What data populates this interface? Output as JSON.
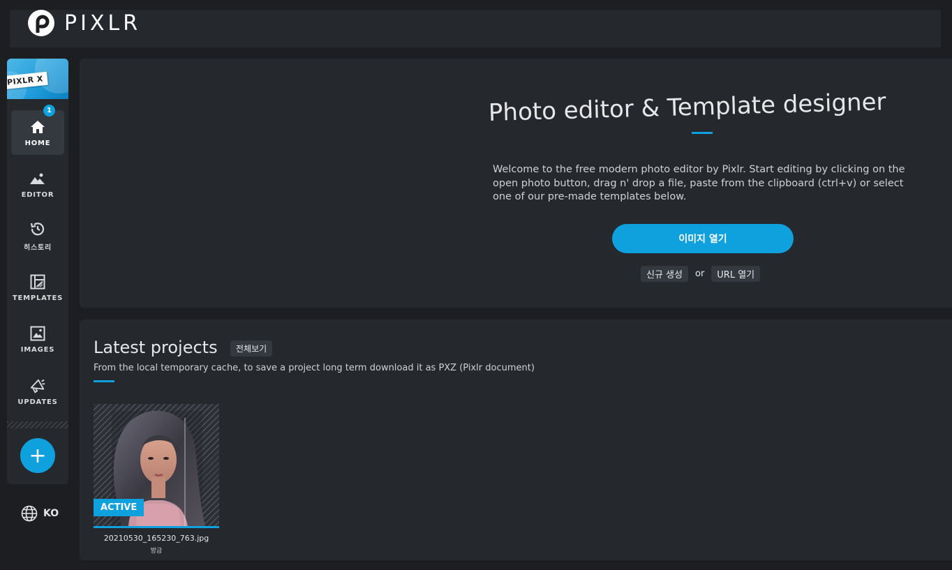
{
  "app": {
    "logo_text": "PIXLR",
    "brand_badge": "PIXLR X"
  },
  "sidebar": {
    "items": [
      {
        "label": "HOME",
        "icon": "home-icon",
        "active": true
      },
      {
        "label": "EDITOR",
        "icon": "image-edit-icon",
        "badge": "1"
      },
      {
        "label": "히스토리",
        "icon": "history-icon"
      },
      {
        "label": "TEMPLATES",
        "icon": "templates-icon"
      },
      {
        "label": "IMAGES",
        "icon": "images-icon"
      },
      {
        "label": "UPDATES",
        "icon": "megaphone-icon"
      }
    ],
    "add_button": "+",
    "language": "KO"
  },
  "hero": {
    "title": "Photo editor & Template designer",
    "description": "Welcome to the free modern photo editor by Pixlr. Start editing by clicking on the open photo button, drag n' drop a file, paste from the clipboard (ctrl+v) or select one of our pre-made templates below.",
    "open_button": "이미지 열기",
    "new_button": "신규 생성",
    "or_text": "or",
    "url_button": "URL 열기"
  },
  "projects": {
    "title": "Latest projects",
    "view_all": "전체보기",
    "subtitle": "From the local temporary cache, to save a project long term download it as PXZ (Pixlr document)",
    "items": [
      {
        "status": "ACTIVE",
        "file_name": "20210530_165230_763.jpg",
        "time": "방금"
      }
    ]
  },
  "colors": {
    "accent": "#0fa0de",
    "panel": "#25282d",
    "background": "#1c1e22"
  }
}
